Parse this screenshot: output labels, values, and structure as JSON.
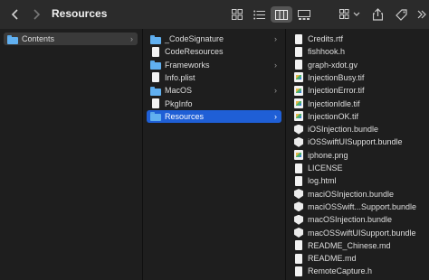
{
  "window": {
    "title": "Resources"
  },
  "columns": {
    "col1": [
      {
        "label": "Contents",
        "icon": "folder-icon",
        "has_children": true,
        "selected": true
      }
    ],
    "col2": [
      {
        "label": "_CodeSignature",
        "icon": "folder-icon",
        "has_children": true
      },
      {
        "label": "CodeResources",
        "icon": "document-icon",
        "has_children": false
      },
      {
        "label": "Frameworks",
        "icon": "folder-icon",
        "has_children": true
      },
      {
        "label": "Info.plist",
        "icon": "document-icon",
        "has_children": false
      },
      {
        "label": "MacOS",
        "icon": "folder-icon",
        "has_children": true
      },
      {
        "label": "PkgInfo",
        "icon": "document-icon",
        "has_children": false
      },
      {
        "label": "Resources",
        "icon": "folder-icon",
        "has_children": true,
        "selected": true
      }
    ],
    "col3": [
      {
        "label": "Credits.rtf",
        "icon": "document-icon"
      },
      {
        "label": "fishhook.h",
        "icon": "document-icon"
      },
      {
        "label": "graph-xdot.gv",
        "icon": "document-icon"
      },
      {
        "label": "InjectionBusy.tif",
        "icon": "image-icon"
      },
      {
        "label": "InjectionError.tif",
        "icon": "image-icon"
      },
      {
        "label": "InjectionIdle.tif",
        "icon": "image-icon"
      },
      {
        "label": "InjectionOK.tif",
        "icon": "image-icon"
      },
      {
        "label": "iOSInjection.bundle",
        "icon": "bundle-icon"
      },
      {
        "label": "iOSSwiftUISupport.bundle",
        "icon": "bundle-icon"
      },
      {
        "label": "iphone.png",
        "icon": "image-icon"
      },
      {
        "label": "LICENSE",
        "icon": "document-icon"
      },
      {
        "label": "log.html",
        "icon": "document-icon"
      },
      {
        "label": "maciOSInjection.bundle",
        "icon": "bundle-icon"
      },
      {
        "label": "maciOSSwift...Support.bundle",
        "icon": "bundle-icon"
      },
      {
        "label": "macOSInjection.bundle",
        "icon": "bundle-icon"
      },
      {
        "label": "macOSSwiftUISupport.bundle",
        "icon": "bundle-icon"
      },
      {
        "label": "README_Chinese.md",
        "icon": "document-icon"
      },
      {
        "label": "README.md",
        "icon": "document-icon"
      },
      {
        "label": "RemoteCapture.h",
        "icon": "document-icon"
      }
    ]
  },
  "colors": {
    "selection": "#1f5fd6",
    "folder": "#61b0f0",
    "background": "#1e1e1e"
  }
}
